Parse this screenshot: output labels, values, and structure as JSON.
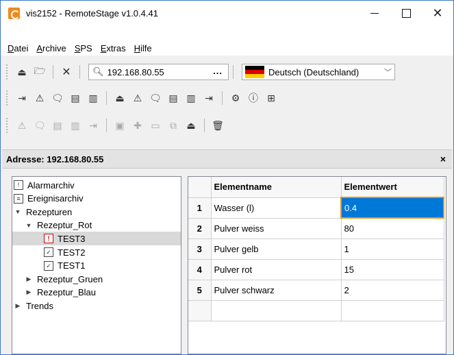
{
  "window": {
    "title": "vis2152 - RemoteStage v1.0.4.41"
  },
  "menu": [
    {
      "key": "D",
      "rest": "atei"
    },
    {
      "key": "A",
      "rest": "rchive"
    },
    {
      "key": "S",
      "rest": "PS"
    },
    {
      "key": "E",
      "rest": "xtras"
    },
    {
      "key": "H",
      "rest": "ilfe"
    }
  ],
  "toolbar": {
    "address_value": "192.168.80.55",
    "address_more": "...",
    "language": "Deutsch (Deutschland)",
    "flag_colors": [
      "#000000",
      "#dd0000",
      "#ffce00"
    ]
  },
  "panel": {
    "header": "Adresse: 192.168.80.55",
    "close": "×"
  },
  "tree": [
    {
      "label": "Alarmarchiv",
      "icon": "alarm-icon",
      "glyph": "!",
      "indent": 0,
      "twisty": ""
    },
    {
      "label": "Ereignisarchiv",
      "icon": "event-icon",
      "glyph": "≡",
      "indent": 0,
      "twisty": ""
    },
    {
      "label": "Rezepturen",
      "icon": "",
      "indent": 0,
      "twisty": "▼"
    },
    {
      "label": "Rezeptur_Rot",
      "icon": "",
      "indent": 1,
      "twisty": "▼"
    },
    {
      "label": "TEST3",
      "icon": "recipe-error-icon",
      "glyph": "!",
      "indent": 2,
      "twisty": "",
      "selected": true
    },
    {
      "label": "TEST2",
      "icon": "recipe-icon",
      "glyph": "✓",
      "indent": 2,
      "twisty": ""
    },
    {
      "label": "TEST1",
      "icon": "recipe-icon",
      "glyph": "✓",
      "indent": 2,
      "twisty": ""
    },
    {
      "label": "Rezeptur_Gruen",
      "icon": "",
      "indent": 1,
      "twisty": "▶"
    },
    {
      "label": "Rezeptur_Blau",
      "icon": "",
      "indent": 1,
      "twisty": "▶"
    },
    {
      "label": "Trends",
      "icon": "",
      "indent": 0,
      "twisty": "▶"
    }
  ],
  "grid": {
    "columns": [
      "Elementname",
      "Elementwert"
    ],
    "rows": [
      {
        "n": "1",
        "name": "Wasser (l)",
        "value": "0.4"
      },
      {
        "n": "2",
        "name": "Pulver weiss",
        "value": "80"
      },
      {
        "n": "3",
        "name": "Pulver gelb",
        "value": "1"
      },
      {
        "n": "4",
        "name": "Pulver rot",
        "value": "15"
      },
      {
        "n": "5",
        "name": "Pulver schwarz",
        "value": "2"
      }
    ]
  }
}
